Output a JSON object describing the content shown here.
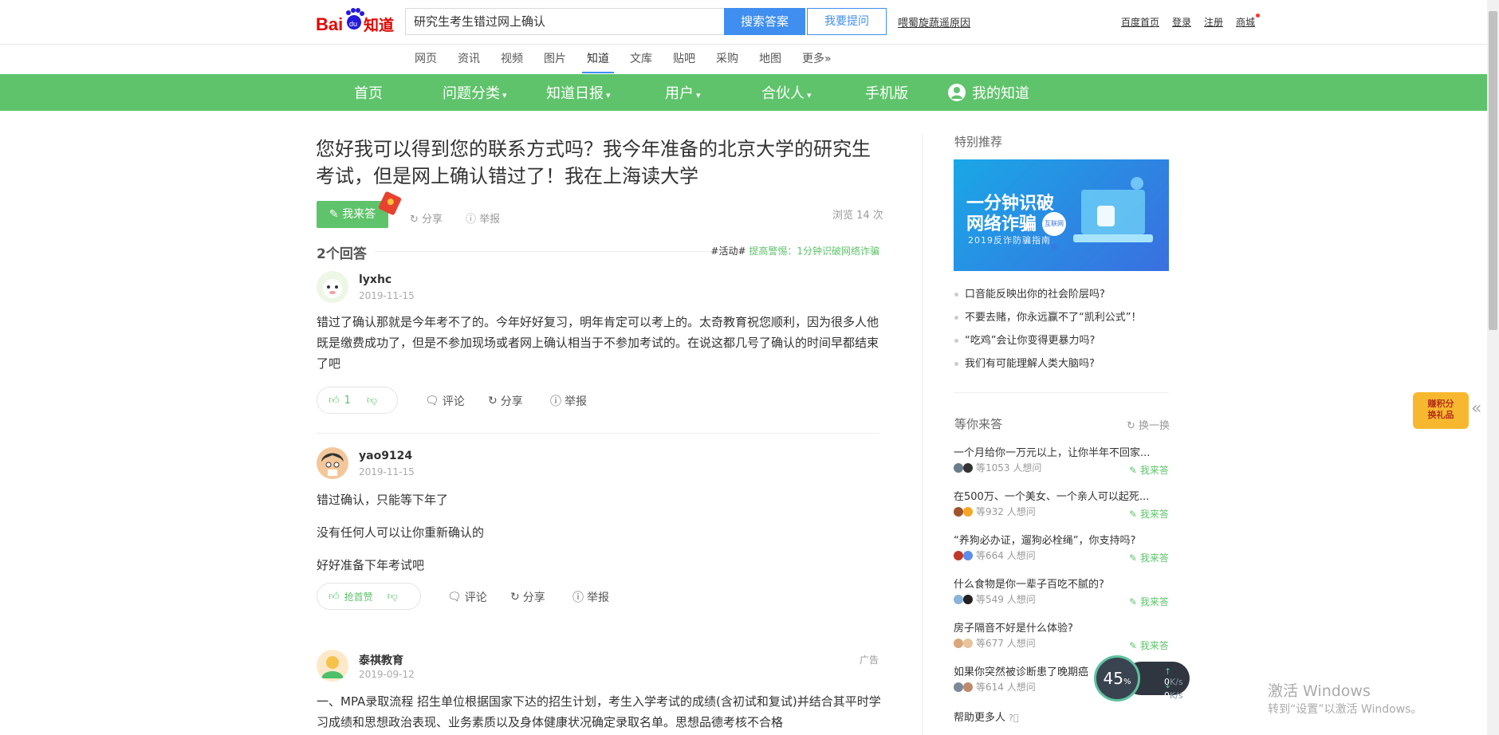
{
  "header": {
    "logo_text": "Bai 知道",
    "search_value": "研究生考生错过网上确认",
    "search_button": "搜索答案",
    "ask_button": "我要提问",
    "help_link": "喂蜀旋蔬遥原因",
    "top_links": [
      "百度首页",
      "登录",
      "注册",
      "商城"
    ],
    "subnav": [
      "网页",
      "资讯",
      "视频",
      "图片",
      "知道",
      "文库",
      "贴吧",
      "采购",
      "地图",
      "更多»"
    ]
  },
  "green_nav": {
    "items": [
      "首页",
      "问题分类",
      "知道日报",
      "用户",
      "合伙人",
      "手机版",
      "我的知道"
    ]
  },
  "question": {
    "title": "您好我可以得到您的联系方式吗？我今年准备的北京大学的研究生考试，但是网上确认错过了！我在上海读大学",
    "answer_button": "我来答",
    "share": "分享",
    "report": "举报",
    "views": "浏览 14 次",
    "answer_count": "2个回答",
    "activity_tag": "#活动#",
    "activity_link": "提高警惕：1分钟识破网络诈骗"
  },
  "answers": [
    {
      "user": "lyxhc",
      "date": "2019-11-15",
      "text": "错过了确认那就是今年考不了的。今年好好复习，明年肯定可以考上的。太奇教育祝您顺利，因为很多人他既是缴费成功了，但是不参加现场或者网上确认相当于不参加考试的。在说这都几号了确认的时间早都结束了吧",
      "likes": "1",
      "comment": "评论",
      "share": "分享",
      "report": "举报"
    },
    {
      "user": "yao9124",
      "date": "2019-11-15",
      "paragraphs": [
        "错过确认，只能等下年了",
        "没有任何人可以让你重新确认的",
        "好好准备下年考试吧"
      ],
      "likes": "抢首赞",
      "comment": "评论",
      "share": "分享",
      "report": "举报"
    },
    {
      "user": "泰祺教育",
      "date": "2019-09-12",
      "ad_tag": "广告",
      "text": "一、MPA录取流程 招生单位根据国家下达的招生计划，考生入学考试的成绩(含初试和复试)并结合其平时学习成绩和思想政治表现、业务素质以及身体健康状况确定录取名单。思想品德考核不合格"
    }
  ],
  "sidebar": {
    "special_title": "特别推荐",
    "banner_line1": "一分钟识破",
    "banner_line2": "网络诈骗",
    "banner_badge": "互联网络",
    "banner_sub": "2019反诈防骗指南",
    "recommend": [
      "口音能反映出你的社会阶层吗?",
      "不要去赌，你永远赢不了“凯利公式”！",
      "“吃鸡”会让你变得更暴力吗?",
      "我们有可能理解人类大脑吗?"
    ],
    "wait_title": "等你来答",
    "refresh": "换一换",
    "waiting": [
      {
        "q": "一个月给你一万元以上，让你半年不回家...",
        "meta": "等1053 人想问",
        "ans": "我来答"
      },
      {
        "q": "在500万、一个美女、一个亲人可以起死...",
        "meta": "等932 人想问",
        "ans": "我来答"
      },
      {
        "q": "“养狗必办证，遛狗必栓绳”，你支持吗?",
        "meta": "等664 人想问",
        "ans": "我来答"
      },
      {
        "q": "什么食物是你一辈子百吃不腻的?",
        "meta": "等549 人想问",
        "ans": "我来答"
      },
      {
        "q": "房子隔音不好是什么体验?",
        "meta": "等677 人想问",
        "ans": "我来答"
      },
      {
        "q": "如果你突然被诊断患了晚期癌",
        "meta": "等614 人想问",
        "ans": ""
      }
    ],
    "more_help": "帮助更多人"
  },
  "float_badge": "赚积分\n换礼品",
  "speed_widget": {
    "percent": "45",
    "unit": "%",
    "up": "0",
    "down": "0",
    "rate_unit": "K/s"
  },
  "watermark": {
    "line1": "激活 Windows",
    "line2": "转到“设置”以激活 Windows。"
  }
}
